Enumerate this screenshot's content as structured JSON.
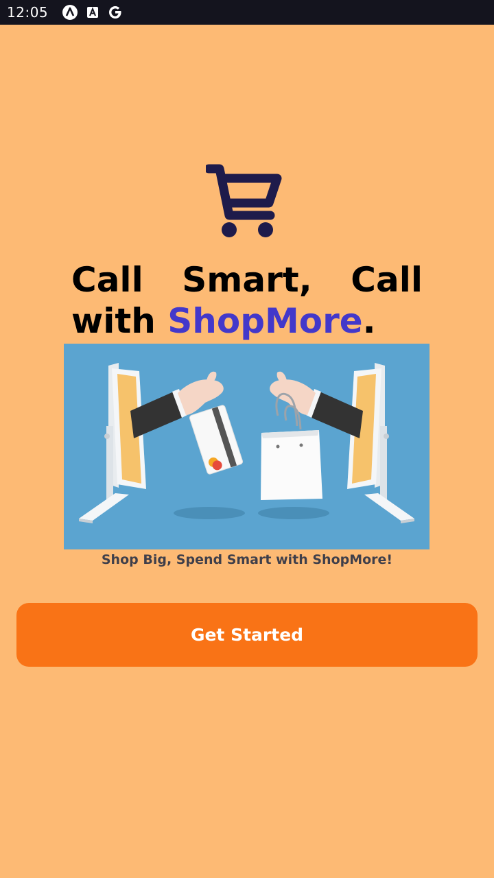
{
  "status_bar": {
    "time": "12:05",
    "icons": [
      "assistant-a-icon",
      "font-a-icon",
      "google-g-icon"
    ]
  },
  "logo": {
    "icon": "shopping-cart-icon",
    "color": "#1E1B4B"
  },
  "headline": {
    "text_prefix": "Call Smart, Call with ",
    "brand": "ShopMore",
    "suffix": ".",
    "brand_color": "#4338CA"
  },
  "hero_image": {
    "icon": "online-shopping-illustration",
    "background": "#5BA4D0"
  },
  "caption": "Shop Big, Spend Smart with ShopMore!",
  "cta": {
    "label": "Get Started",
    "color": "#F97316"
  },
  "theme": {
    "background": "#FDBA74",
    "status_bar": "#14141E"
  }
}
